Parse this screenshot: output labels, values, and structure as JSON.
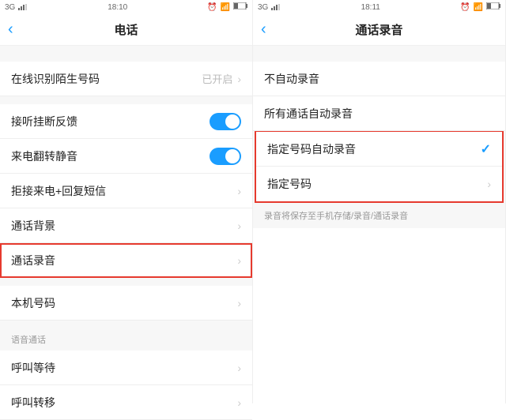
{
  "left": {
    "status": {
      "network": "3G",
      "time": "18:10"
    },
    "title": "电话",
    "rows": {
      "online_id": {
        "label": "在线识别陌生号码",
        "value": "已开启"
      },
      "answer_hangup": {
        "label": "接听挂断反馈"
      },
      "flip_mute": {
        "label": "来电翻转静音"
      },
      "reject_sms": {
        "label": "拒接来电+回复短信"
      },
      "call_bg": {
        "label": "通话背景"
      },
      "call_record": {
        "label": "通话录音"
      },
      "my_number": {
        "label": "本机号码"
      },
      "voice_section": "语音通话",
      "call_waiting": {
        "label": "呼叫等待"
      },
      "call_forward": {
        "label": "呼叫转移"
      }
    }
  },
  "right": {
    "status": {
      "network": "3G",
      "time": "18:11"
    },
    "title": "通话录音",
    "rows": {
      "no_auto": {
        "label": "不自动录音"
      },
      "all_auto": {
        "label": "所有通话自动录音"
      },
      "specified_auto": {
        "label": "指定号码自动录音"
      },
      "specified_numbers": {
        "label": "指定号码"
      }
    },
    "footnote": "录音将保存至手机存储/录音/通话录音"
  }
}
